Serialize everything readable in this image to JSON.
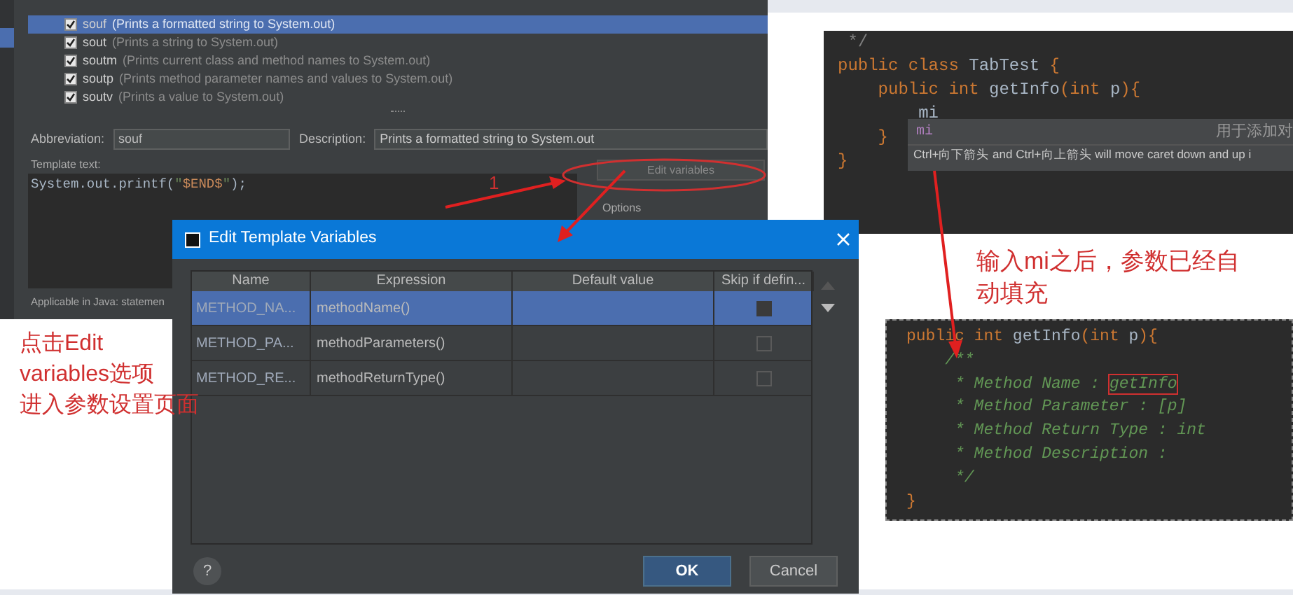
{
  "templates_panel": {
    "list": [
      {
        "abbr": "souf",
        "description": "(Prints a formatted string to System.out)",
        "checked": true,
        "selected": true
      },
      {
        "abbr": "sout",
        "description": "(Prints a string to System.out)",
        "checked": true,
        "selected": false
      },
      {
        "abbr": "soutm",
        "description": "(Prints current class and method names to System.out)",
        "checked": true,
        "selected": false
      },
      {
        "abbr": "soutp",
        "description": "(Prints method parameter names and values to System.out)",
        "checked": true,
        "selected": false
      },
      {
        "abbr": "soutv",
        "description": "(Prints a value to System.out)",
        "checked": true,
        "selected": false
      }
    ],
    "abbreviation_label": "Abbreviation:",
    "abbreviation": "souf",
    "description_label": "Description:",
    "description": "Prints a formatted string to System.out",
    "template_label": "Template text:",
    "template_text": [
      {
        "text": "System.out.printf(",
        "kind": "plain"
      },
      {
        "text": "\"",
        "kind": "string"
      },
      {
        "text": "$END$",
        "kind": "var"
      },
      {
        "text": "\"",
        "kind": "string"
      },
      {
        "text": ");",
        "kind": "plain"
      }
    ],
    "edit_variables_button": "Edit variables",
    "options_label": "Options",
    "applicable": "Applicable in Java: statemen"
  },
  "dialog": {
    "title": "Edit Template Variables",
    "columns": [
      "Name",
      "Expression",
      "Default value",
      "Skip if defin..."
    ],
    "rows": [
      {
        "name": "METHOD_NA...",
        "expression": "methodName()",
        "skip": false,
        "selected": true
      },
      {
        "name": "METHOD_PA...",
        "expression": "methodParameters()",
        "skip": false,
        "selected": false
      },
      {
        "name": "METHOD_RE...",
        "expression": "methodReturnType()",
        "skip": false,
        "selected": false
      }
    ],
    "help_button": "?",
    "buttons": [
      {
        "label": "OK",
        "kind": "primary"
      },
      {
        "label": "Cancel",
        "kind": "secondary"
      }
    ]
  },
  "editor_top": {
    "lines": [
      [
        {
          "text": " */",
          "kind": "comment"
        }
      ],
      [
        {
          "text": "public class ",
          "kind": "kw"
        },
        {
          "text": "TabTest ",
          "kind": "plain"
        },
        {
          "text": "{",
          "kind": "kw"
        }
      ],
      [
        {
          "text": "    public int ",
          "kind": "kw"
        },
        {
          "text": "getInfo",
          "kind": "plain"
        },
        {
          "text": "(",
          "kind": "kw"
        },
        {
          "text": "int ",
          "kind": "kw"
        },
        {
          "text": "p",
          "kind": "plain"
        },
        {
          "text": "){",
          "kind": "kw"
        }
      ],
      [
        {
          "text": "        mi",
          "kind": "plain"
        }
      ],
      [
        {
          "text": "    }",
          "kind": "kw"
        }
      ],
      [
        {
          "text": "}",
          "kind": "kw"
        }
      ]
    ],
    "completion_popup": {
      "item": "mi",
      "hint": "用于添加对",
      "footer": "Ctrl+向下箭头 and Ctrl+向上箭头 will move caret down and up i"
    }
  },
  "editor_bottom": {
    "lines": [
      [
        {
          "text": "public ",
          "kind": "kw"
        },
        {
          "text": "int ",
          "kind": "kw"
        },
        {
          "text": "getInfo",
          "kind": "plain"
        },
        {
          "text": "(",
          "kind": "kw"
        },
        {
          "text": "int ",
          "kind": "kw"
        },
        {
          "text": "p",
          "kind": "plain"
        },
        {
          "text": "){",
          "kind": "kw"
        }
      ],
      [
        {
          "text": "    /**",
          "kind": "doc"
        }
      ],
      [
        {
          "text": "     * Method Name : ",
          "kind": "doc"
        },
        {
          "text": "getInfo",
          "kind": "boxed"
        }
      ],
      [
        {
          "text": "     * Method Parameter : [p]",
          "kind": "doc"
        }
      ],
      [
        {
          "text": "     * Method Return Type : int",
          "kind": "doc"
        }
      ],
      [
        {
          "text": "     * Method Description :",
          "kind": "doc"
        }
      ],
      [
        {
          "text": "     */",
          "kind": "doc"
        }
      ],
      [
        {
          "text": "}",
          "kind": "kw"
        }
      ]
    ]
  },
  "annotations": {
    "step": "1",
    "left_note": [
      "点击Edit",
      "variables选项",
      "进入参数设置页面"
    ],
    "right_note": [
      "输入mi之后，参数已经自",
      "动填充"
    ]
  }
}
